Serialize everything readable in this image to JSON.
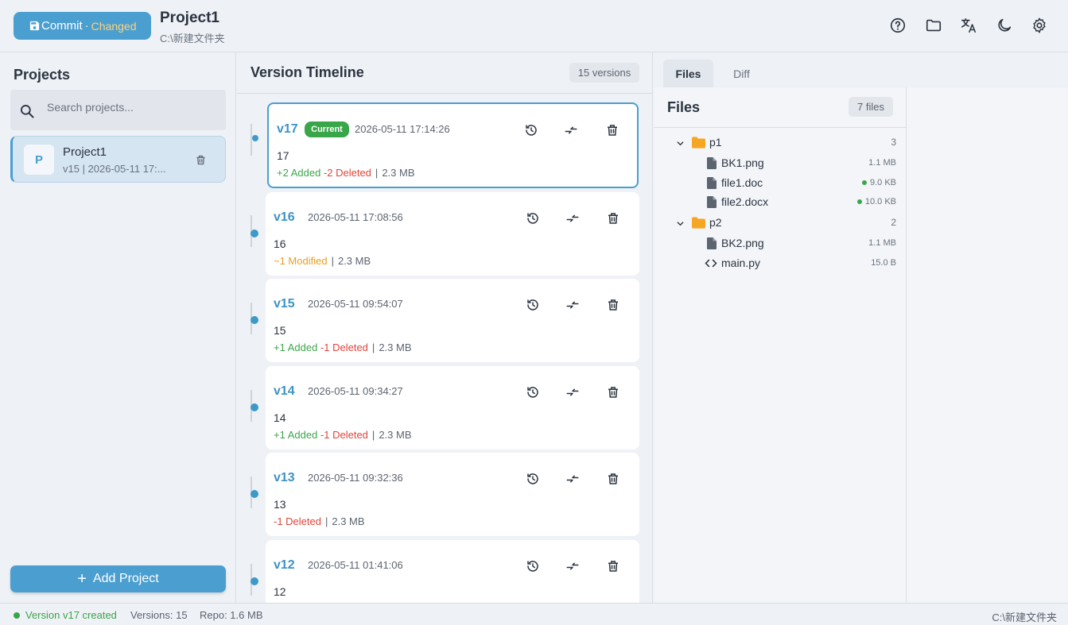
{
  "header": {
    "commit_label": "Commit",
    "commit_sep": "·",
    "commit_state": "Changed",
    "project_title": "Project1",
    "project_path": "C:\\新建文件夹",
    "icons": [
      "help-icon",
      "folder-icon",
      "translate-icon",
      "moon-icon",
      "gear-icon"
    ]
  },
  "sidebar": {
    "title": "Projects",
    "search_placeholder": "Search projects...",
    "projects": [
      {
        "avatar": "P",
        "name": "Project1",
        "meta": "v15  |  2026-05-11 17:..."
      }
    ],
    "add_label": "Add Project"
  },
  "timeline": {
    "title": "Version Timeline",
    "count": "15 versions",
    "current_badge": "Current",
    "versions": [
      {
        "ver": "v17",
        "date": "2026-05-11 17:14:26",
        "msg": "17",
        "added": "+2 Added",
        "deleted": "-2 Deleted",
        "modified": "",
        "size": "2.3 MB"
      },
      {
        "ver": "v16",
        "date": "2026-05-11 17:08:56",
        "msg": "16",
        "added": "",
        "deleted": "",
        "modified": "~1 Modified",
        "size": "2.3 MB"
      },
      {
        "ver": "v15",
        "date": "2026-05-11 09:54:07",
        "msg": "15",
        "added": "+1 Added",
        "deleted": "-1 Deleted",
        "modified": "",
        "size": "2.3 MB"
      },
      {
        "ver": "v14",
        "date": "2026-05-11 09:34:27",
        "msg": "14",
        "added": "+1 Added",
        "deleted": "-1 Deleted",
        "modified": "",
        "size": "2.3 MB"
      },
      {
        "ver": "v13",
        "date": "2026-05-11 09:32:36",
        "msg": "13",
        "added": "",
        "deleted": "-1 Deleted",
        "modified": "",
        "size": "2.3 MB"
      },
      {
        "ver": "v12",
        "date": "2026-05-11 01:41:06",
        "msg": "12",
        "added": "",
        "deleted": "",
        "modified": "",
        "size": ""
      }
    ]
  },
  "right": {
    "tabs": [
      "Files",
      "Diff"
    ],
    "files_title": "Files",
    "files_count": "7 files",
    "tree": [
      {
        "type": "folder",
        "name": "p1",
        "count": "3"
      },
      {
        "type": "file",
        "name": "BK1.png",
        "size": "1.1 MB",
        "changed": false
      },
      {
        "type": "file",
        "name": "file1.doc",
        "size": "9.0 KB",
        "changed": true
      },
      {
        "type": "file",
        "name": "file2.docx",
        "size": "10.0 KB",
        "changed": true
      },
      {
        "type": "folder",
        "name": "p2",
        "count": "2"
      },
      {
        "type": "file",
        "name": "BK2.png",
        "size": "1.1 MB",
        "changed": false
      },
      {
        "type": "code",
        "name": "main.py",
        "size": "15.0 B",
        "changed": false
      }
    ]
  },
  "status": {
    "message": "Version v17 created",
    "versions": "Versions: 15",
    "repo": "Repo: 1.6 MB",
    "path": "C:\\新建文件夹"
  },
  "colors": {
    "accent": "#4a9fd0",
    "added": "#3aa64a",
    "deleted": "#e0443a",
    "modified": "#e8a022",
    "folder": "#f5a623"
  }
}
